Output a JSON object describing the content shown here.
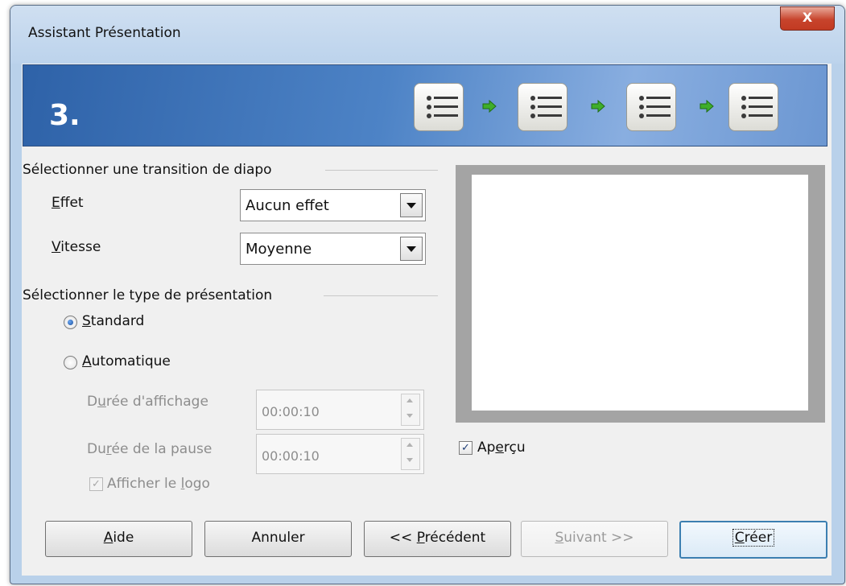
{
  "window": {
    "title": "Assistant Présentation",
    "close_label": "X"
  },
  "banner": {
    "step": "3.",
    "icons": [
      "list-icon",
      "list-icon",
      "list-icon",
      "list-icon"
    ]
  },
  "transition_section": {
    "heading": "Sélectionner une transition de diapo",
    "effect_label_mnemonic": "E",
    "effect_label_rest": "ffet",
    "effect_value": "Aucun effet",
    "speed_label_mnemonic": "V",
    "speed_label_rest": "itesse",
    "speed_value": "Moyenne"
  },
  "type_section": {
    "heading": "Sélectionner le type de présentation",
    "standard_mnemonic": "S",
    "standard_rest": "tandard",
    "standard_checked": true,
    "automatic_mnemonic": "A",
    "automatic_rest": "utomatique",
    "automatic_checked": false,
    "display_duration_pre": "D",
    "display_duration_mnemonic": "u",
    "display_duration_rest": "rée d'affichage",
    "display_duration_value": "00:00:10",
    "pause_duration_pre": "Du",
    "pause_duration_mnemonic": "r",
    "pause_duration_rest": "ée de la pause",
    "pause_duration_value": "00:00:10",
    "show_logo_pre": "Afficher le ",
    "show_logo_mnemonic": "l",
    "show_logo_rest": "ogo",
    "show_logo_checked": true
  },
  "preview": {
    "label_pre": "Ap",
    "label_mnemonic": "e",
    "label_rest": "rçu",
    "checked": true
  },
  "buttons": {
    "help_mnemonic": "A",
    "help_rest": "ide",
    "cancel": "Annuler",
    "back_pre": "<< ",
    "back_mnemonic": "P",
    "back_rest": "récédent",
    "next_mnemonic": "S",
    "next_rest": "uivant >>",
    "create_mnemonic": "C",
    "create_rest": "réer"
  },
  "colors": {
    "banner_dark": "#2e62a8",
    "banner_light": "#89aee0",
    "arrow_green": "#3fae2a",
    "close_red": "#c7442c",
    "default_button_border": "#3c7fb1"
  }
}
